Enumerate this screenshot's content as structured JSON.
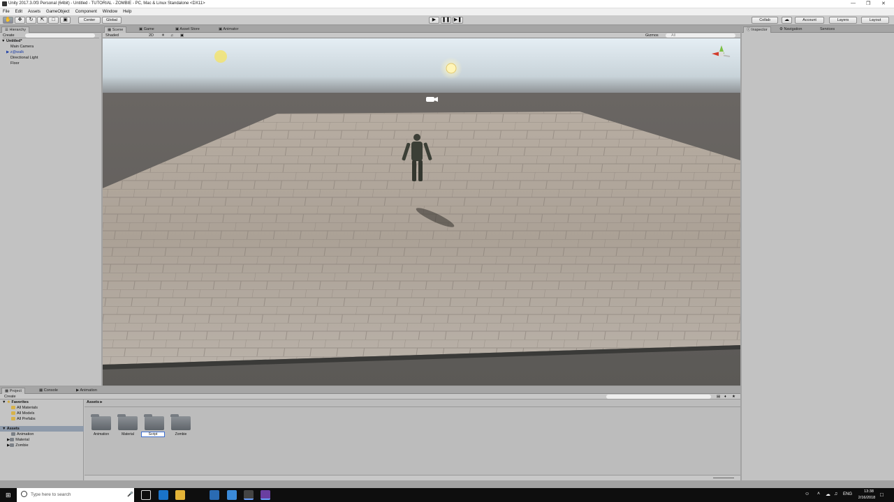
{
  "window": {
    "title": "Unity 2017.3.0f3 Personal (64bit) - Untitled - TUTORIAL - ZOMBIE - PC, Mac & Linux Standalone <DX11>"
  },
  "menu": [
    "File",
    "Edit",
    "Assets",
    "GameObject",
    "Component",
    "Window",
    "Help"
  ],
  "toolbar": {
    "pivot": "Center",
    "space": "Global",
    "collab": "Collab",
    "account": "Account",
    "layers": "Layers",
    "layout": "Layout"
  },
  "hierarchy": {
    "tab": "Hierarchy",
    "create": "Create",
    "scene": "Untitled*",
    "items": [
      "Main Camera",
      "z@walk",
      "Directional Light",
      "Floor"
    ]
  },
  "scene_tabs": [
    "Scene",
    "Game",
    "Asset Store",
    "Animator"
  ],
  "scene_toolbar": {
    "shading": "Shaded",
    "mode2d": "2D",
    "gizmos": "Gizmos",
    "search": "All"
  },
  "inspector_tabs": [
    "Inspector",
    "Navigation",
    "Services"
  ],
  "project": {
    "tabs": [
      "Project",
      "Console",
      "Animation"
    ],
    "create": "Create",
    "favorites": "Favorites",
    "favorite_items": [
      "All Materials",
      "All Models",
      "All Prefabs"
    ],
    "assets_root": "Assets",
    "asset_folders": [
      "Animation",
      "Material",
      "Zombie"
    ],
    "breadcrumb": "Assets",
    "folders": [
      "Animation",
      "Material",
      "Script",
      "Zombie"
    ]
  },
  "taskbar": {
    "search_placeholder": "Type here to search",
    "lang": "ENG",
    "time": "13:38",
    "date": "2/16/2018"
  },
  "colors": {
    "accent": "#3d6fd1",
    "sky_top": "#e4edf3",
    "ground": "#5c5a57"
  }
}
